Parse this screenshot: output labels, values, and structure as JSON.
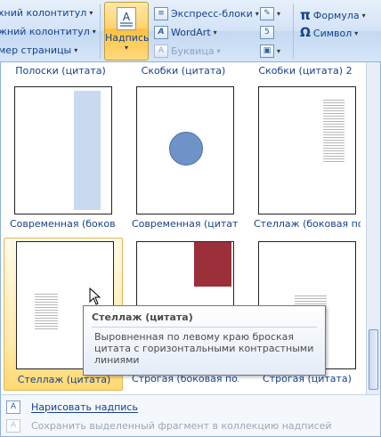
{
  "ribbon": {
    "left_items": [
      "хний колонтитул",
      "жний колонтитул",
      "мер страницы"
    ],
    "nadpis_label": "Надпись",
    "nadpis_icon": "A",
    "mid_items": [
      "Экспресс-блоки",
      "WordArt",
      "Буквица"
    ],
    "right_items": [
      "Формула",
      "Символ"
    ],
    "formula_icon": "π",
    "symbol_icon": "Ω"
  },
  "gallery": {
    "top_captions": [
      "Полоски (цитата)",
      "Скобки (цитата)",
      "Скобки (цитата) 2"
    ],
    "row1_captions": [
      "Современная (боков...",
      "Современная (цитата)",
      "Стеллаж (боковая пол..."
    ],
    "row2_captions": [
      "Стеллаж (цитата)",
      "Строгая (боковая пол...",
      "Строгая (цитата)"
    ]
  },
  "tooltip": {
    "title": "Стеллаж (цитата)",
    "description": "Выровненная по левому краю броская цитата с горизонтальными контрастными линиями"
  },
  "menu": {
    "draw_label": "Нарисовать надпись",
    "save_label": "Сохранить выделенный фрагмент в коллекцию надписей"
  },
  "colors": {
    "accent": "#15428b",
    "selection": "#ffd36b",
    "maroon_block": "#9b2f3a",
    "circle": "#6f93c8"
  }
}
